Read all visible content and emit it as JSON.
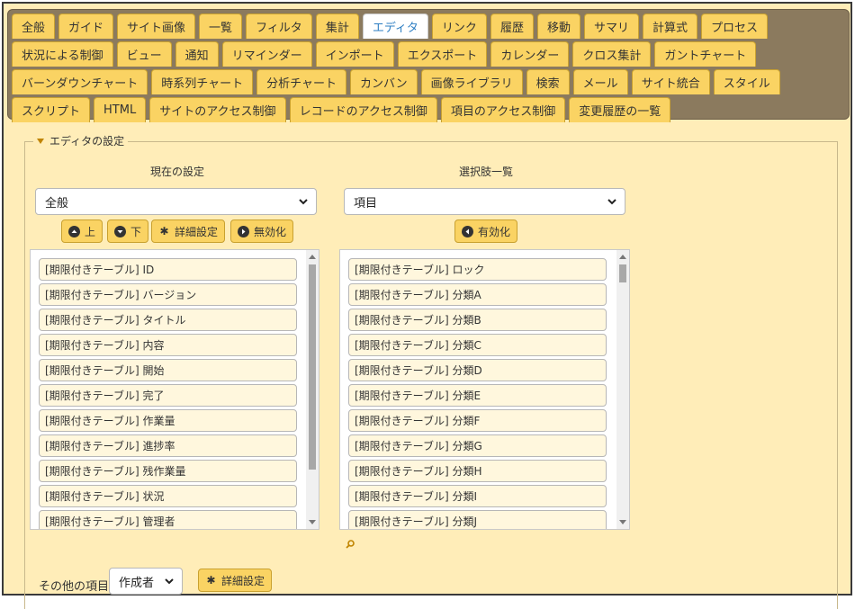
{
  "tabs": {
    "row1": [
      "全般",
      "ガイド",
      "サイト画像",
      "一覧",
      "フィルタ",
      "集計",
      "エディタ",
      "リンク",
      "履歴",
      "移動",
      "サマリ",
      "計算式",
      "プロセス"
    ],
    "row2": [
      "状況による制御",
      "ビュー",
      "通知",
      "リマインダー",
      "インポート",
      "エクスポート",
      "カレンダー",
      "クロス集計",
      "ガントチャート"
    ],
    "row3": [
      "バーンダウンチャート",
      "時系列チャート",
      "分析チャート",
      "カンバン",
      "画像ライブラリ",
      "検索",
      "メール",
      "サイト統合",
      "スタイル"
    ],
    "row4": [
      "スクリプト",
      "HTML",
      "サイトのアクセス制御",
      "レコードのアクセス制御",
      "項目のアクセス制御",
      "変更履歴の一覧"
    ],
    "active": "エディタ"
  },
  "editor": {
    "legend": "エディタの設定",
    "current": {
      "title": "現在の設定",
      "select_value": "全般",
      "buttons": {
        "up": "上",
        "down": "下",
        "detail": "詳細設定",
        "disable": "無効化"
      },
      "items": [
        "[期限付きテーブル] ID",
        "[期限付きテーブル] バージョン",
        "[期限付きテーブル] タイトル",
        "[期限付きテーブル] 内容",
        "[期限付きテーブル] 開始",
        "[期限付きテーブル] 完了",
        "[期限付きテーブル] 作業量",
        "[期限付きテーブル] 進捗率",
        "[期限付きテーブル] 残作業量",
        "[期限付きテーブル] 状況",
        "[期限付きテーブル] 管理者"
      ]
    },
    "options": {
      "title": "選択肢一覧",
      "select_value": "項目",
      "buttons": {
        "enable": "有効化"
      },
      "items": [
        "[期限付きテーブル] ロック",
        "[期限付きテーブル] 分類A",
        "[期限付きテーブル] 分類B",
        "[期限付きテーブル] 分類C",
        "[期限付きテーブル] 分類D",
        "[期限付きテーブル] 分類E",
        "[期限付きテーブル] 分類F",
        "[期限付きテーブル] 分類G",
        "[期限付きテーブル] 分類H",
        "[期限付きテーブル] 分類I",
        "[期限付きテーブル] 分類J"
      ]
    },
    "other": {
      "label": "その他の項目",
      "select_value": "作成者",
      "detail_button": "詳細設定"
    }
  },
  "colors": {
    "tab": "#fad363",
    "active_tab_text": "#2f7fc3",
    "panel_bg": "#ffedb8",
    "tabbar_bg": "#8b7a5e"
  }
}
